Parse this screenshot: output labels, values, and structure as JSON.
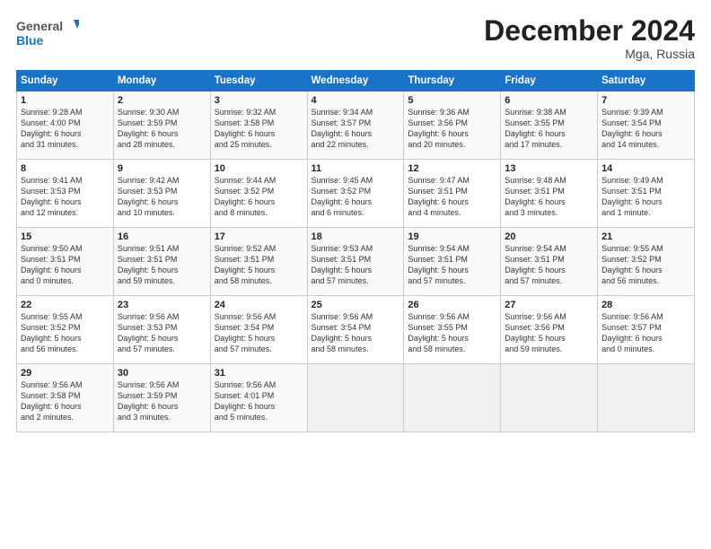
{
  "header": {
    "logo_line1": "General",
    "logo_line2": "Blue",
    "month": "December 2024",
    "location": "Mga, Russia"
  },
  "weekdays": [
    "Sunday",
    "Monday",
    "Tuesday",
    "Wednesday",
    "Thursday",
    "Friday",
    "Saturday"
  ],
  "weeks": [
    [
      {
        "day": "1",
        "info": "Sunrise: 9:28 AM\nSunset: 4:00 PM\nDaylight: 6 hours\nand 31 minutes."
      },
      {
        "day": "2",
        "info": "Sunrise: 9:30 AM\nSunset: 3:59 PM\nDaylight: 6 hours\nand 28 minutes."
      },
      {
        "day": "3",
        "info": "Sunrise: 9:32 AM\nSunset: 3:58 PM\nDaylight: 6 hours\nand 25 minutes."
      },
      {
        "day": "4",
        "info": "Sunrise: 9:34 AM\nSunset: 3:57 PM\nDaylight: 6 hours\nand 22 minutes."
      },
      {
        "day": "5",
        "info": "Sunrise: 9:36 AM\nSunset: 3:56 PM\nDaylight: 6 hours\nand 20 minutes."
      },
      {
        "day": "6",
        "info": "Sunrise: 9:38 AM\nSunset: 3:55 PM\nDaylight: 6 hours\nand 17 minutes."
      },
      {
        "day": "7",
        "info": "Sunrise: 9:39 AM\nSunset: 3:54 PM\nDaylight: 6 hours\nand 14 minutes."
      }
    ],
    [
      {
        "day": "8",
        "info": "Sunrise: 9:41 AM\nSunset: 3:53 PM\nDaylight: 6 hours\nand 12 minutes."
      },
      {
        "day": "9",
        "info": "Sunrise: 9:42 AM\nSunset: 3:53 PM\nDaylight: 6 hours\nand 10 minutes."
      },
      {
        "day": "10",
        "info": "Sunrise: 9:44 AM\nSunset: 3:52 PM\nDaylight: 6 hours\nand 8 minutes."
      },
      {
        "day": "11",
        "info": "Sunrise: 9:45 AM\nSunset: 3:52 PM\nDaylight: 6 hours\nand 6 minutes."
      },
      {
        "day": "12",
        "info": "Sunrise: 9:47 AM\nSunset: 3:51 PM\nDaylight: 6 hours\nand 4 minutes."
      },
      {
        "day": "13",
        "info": "Sunrise: 9:48 AM\nSunset: 3:51 PM\nDaylight: 6 hours\nand 3 minutes."
      },
      {
        "day": "14",
        "info": "Sunrise: 9:49 AM\nSunset: 3:51 PM\nDaylight: 6 hours\nand 1 minute."
      }
    ],
    [
      {
        "day": "15",
        "info": "Sunrise: 9:50 AM\nSunset: 3:51 PM\nDaylight: 6 hours\nand 0 minutes."
      },
      {
        "day": "16",
        "info": "Sunrise: 9:51 AM\nSunset: 3:51 PM\nDaylight: 5 hours\nand 59 minutes."
      },
      {
        "day": "17",
        "info": "Sunrise: 9:52 AM\nSunset: 3:51 PM\nDaylight: 5 hours\nand 58 minutes."
      },
      {
        "day": "18",
        "info": "Sunrise: 9:53 AM\nSunset: 3:51 PM\nDaylight: 5 hours\nand 57 minutes."
      },
      {
        "day": "19",
        "info": "Sunrise: 9:54 AM\nSunset: 3:51 PM\nDaylight: 5 hours\nand 57 minutes."
      },
      {
        "day": "20",
        "info": "Sunrise: 9:54 AM\nSunset: 3:51 PM\nDaylight: 5 hours\nand 57 minutes."
      },
      {
        "day": "21",
        "info": "Sunrise: 9:55 AM\nSunset: 3:52 PM\nDaylight: 5 hours\nand 56 minutes."
      }
    ],
    [
      {
        "day": "22",
        "info": "Sunrise: 9:55 AM\nSunset: 3:52 PM\nDaylight: 5 hours\nand 56 minutes."
      },
      {
        "day": "23",
        "info": "Sunrise: 9:56 AM\nSunset: 3:53 PM\nDaylight: 5 hours\nand 57 minutes."
      },
      {
        "day": "24",
        "info": "Sunrise: 9:56 AM\nSunset: 3:54 PM\nDaylight: 5 hours\nand 57 minutes."
      },
      {
        "day": "25",
        "info": "Sunrise: 9:56 AM\nSunset: 3:54 PM\nDaylight: 5 hours\nand 58 minutes."
      },
      {
        "day": "26",
        "info": "Sunrise: 9:56 AM\nSunset: 3:55 PM\nDaylight: 5 hours\nand 58 minutes."
      },
      {
        "day": "27",
        "info": "Sunrise: 9:56 AM\nSunset: 3:56 PM\nDaylight: 5 hours\nand 59 minutes."
      },
      {
        "day": "28",
        "info": "Sunrise: 9:56 AM\nSunset: 3:57 PM\nDaylight: 6 hours\nand 0 minutes."
      }
    ],
    [
      {
        "day": "29",
        "info": "Sunrise: 9:56 AM\nSunset: 3:58 PM\nDaylight: 6 hours\nand 2 minutes."
      },
      {
        "day": "30",
        "info": "Sunrise: 9:56 AM\nSunset: 3:59 PM\nDaylight: 6 hours\nand 3 minutes."
      },
      {
        "day": "31",
        "info": "Sunrise: 9:56 AM\nSunset: 4:01 PM\nDaylight: 6 hours\nand 5 minutes."
      },
      {
        "day": "",
        "info": ""
      },
      {
        "day": "",
        "info": ""
      },
      {
        "day": "",
        "info": ""
      },
      {
        "day": "",
        "info": ""
      }
    ]
  ]
}
